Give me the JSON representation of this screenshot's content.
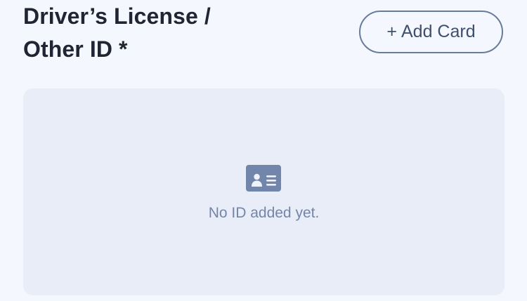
{
  "section": {
    "title_line1": "Driver’s License /",
    "title_line2": "Other ID *",
    "add_button": {
      "icon": "+",
      "label": "Add Card"
    }
  },
  "empty_state": {
    "icon": "id-card-icon",
    "message": "No ID added yet."
  },
  "colors": {
    "background": "#f4f7fd",
    "panel": "#e9edf7",
    "title": "#1f2533",
    "button_border": "#6a7c9a",
    "muted_text": "#7285ab"
  }
}
